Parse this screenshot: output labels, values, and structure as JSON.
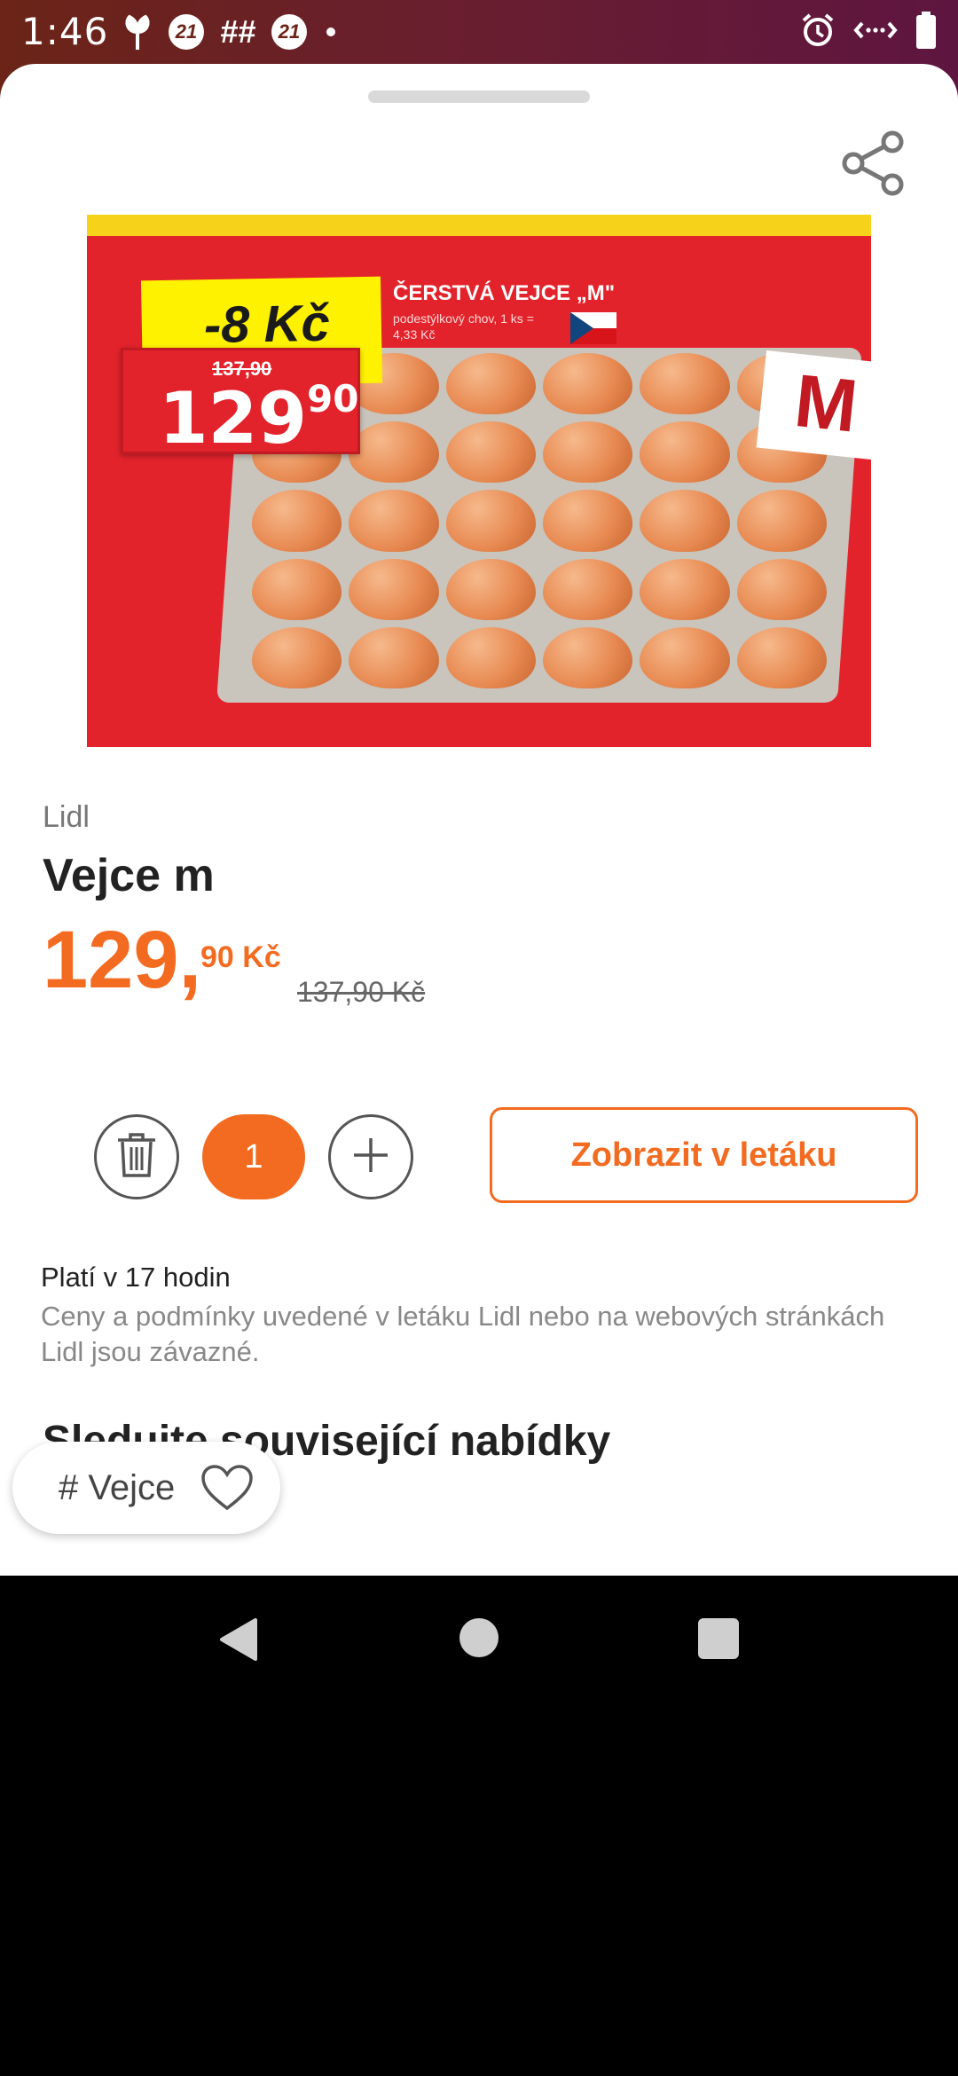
{
  "status_bar": {
    "time": "1:46",
    "left_icons": [
      "plant-icon",
      "badge-21-icon",
      "hash-icon",
      "badge-21-icon",
      "dot-icon"
    ],
    "badge_text": "21",
    "hash_text": "##",
    "right_icons": [
      "alarm-icon",
      "data-saver-icon",
      "battery-icon"
    ]
  },
  "image": {
    "discount": "-8 Kč",
    "old_price": "137,90",
    "new_price_whole": "129",
    "new_price_cents": "90",
    "product_name": "ČERSTVÁ VEJCE „M\"",
    "product_desc": "podestýlkový chov, 1 ks = 4,33 Kč",
    "size_label": "M"
  },
  "product": {
    "store": "Lidl",
    "title": "Vejce m",
    "price_whole": "129,",
    "price_cents": "90 Kč",
    "old_price": "137,90 Kč"
  },
  "quantity": {
    "value": "1"
  },
  "actions": {
    "show_in_flyer": "Zobrazit v letáku"
  },
  "info": {
    "validity": "Platí v 17 hodin",
    "disclaimer": "Ceny a podmínky uvedené v letáku Lidl nebo na webových stránkách Lidl jsou závazné."
  },
  "related": {
    "title": "Sledujte související nabídky",
    "tags": [
      {
        "label": "# Vejce"
      }
    ]
  },
  "colors": {
    "accent": "#f36b21",
    "status_bar": "#6a1f2e"
  }
}
